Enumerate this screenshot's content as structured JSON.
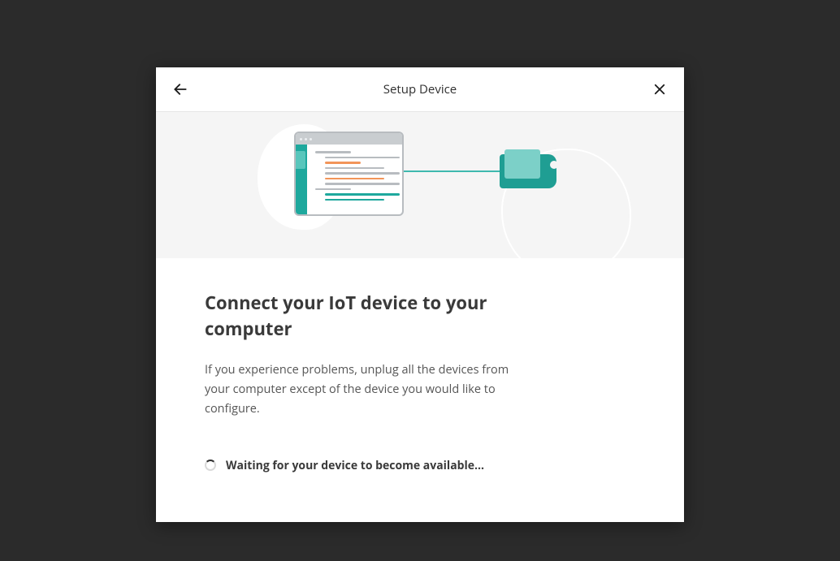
{
  "header": {
    "title": "Setup Device"
  },
  "main": {
    "heading": "Connect your IoT device to your computer",
    "description": "If you experience problems, unplug all the devices from your computer except of the device you would like to configure."
  },
  "status": {
    "message": "Waiting for your device to become available..."
  }
}
